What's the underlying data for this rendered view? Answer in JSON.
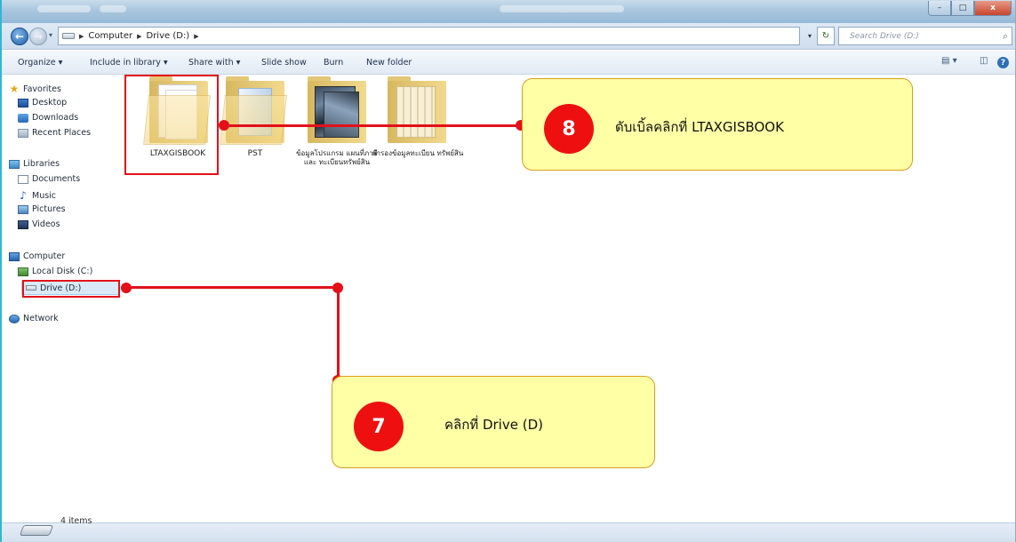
{
  "window": {
    "controls": {
      "minimize": "–",
      "maximize": "□",
      "close": "x"
    }
  },
  "address": {
    "path": [
      "Computer",
      "Drive (D:)"
    ],
    "search_placeholder": "Search Drive (D:)"
  },
  "toolbar": {
    "organize": "Organize ▾",
    "include_in_library": "Include in library ▾",
    "share_with": "Share with ▾",
    "slide_show": "Slide show",
    "burn": "Burn",
    "new_folder": "New folder",
    "help": "?"
  },
  "sidebar": {
    "favorites": "Favorites",
    "desktop": "Desktop",
    "downloads": "Downloads",
    "recent_places": "Recent Places",
    "libraries": "Libraries",
    "documents": "Documents",
    "music": "Music",
    "pictures": "Pictures",
    "videos": "Videos",
    "computer": "Computer",
    "local_disk": "Local Disk (C:)",
    "drive_d": "Drive (D:)",
    "network": "Network"
  },
  "folders": [
    {
      "name": "LTAXGISBOOK"
    },
    {
      "name": "PST"
    },
    {
      "name": "ข้อมูลโปรแกรม แผนที่ภาษีและ ทะเบียนทรัพย์สิน"
    },
    {
      "name": "สำรองข้อมูลทะเบียน ทรัพย์สิน"
    }
  ],
  "status": {
    "items": "4 items"
  },
  "annotations": {
    "step8": {
      "number": "8",
      "text": "ดับเบิ้ลคลิกที่   LTAXGISBOOK"
    },
    "step7": {
      "number": "7",
      "text": "คลิกที่ Drive (D)"
    },
    "color": "#e3101a",
    "callout_fill": "#ffffa6"
  }
}
